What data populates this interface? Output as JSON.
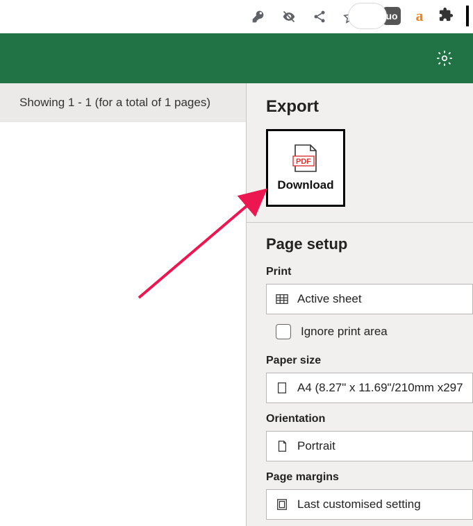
{
  "browser": {
    "extensions": {
      "ublock_label": "uo",
      "letter_a": "a"
    }
  },
  "left_panel": {
    "showing_text": "Showing 1 - 1 (for a total of 1 pages)"
  },
  "right_panel": {
    "export_heading": "Export",
    "download": {
      "badge": "PDF",
      "label": "Download"
    },
    "page_setup_heading": "Page setup",
    "print": {
      "label": "Print",
      "value": "Active sheet",
      "ignore_label": "Ignore print area"
    },
    "paper_size": {
      "label": "Paper size",
      "value": "A4 (8.27\" x 11.69\"/210mm x297"
    },
    "orientation": {
      "label": "Orientation",
      "value": "Portrait"
    },
    "page_margins": {
      "label": "Page margins",
      "value": "Last customised setting"
    }
  }
}
